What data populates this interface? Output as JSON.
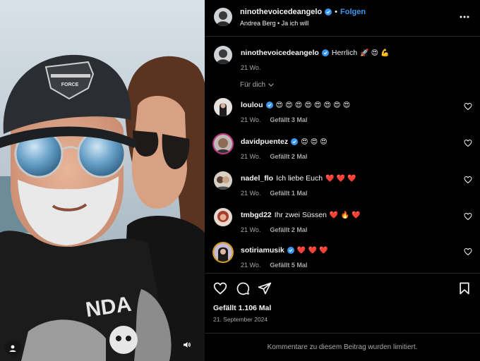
{
  "media": {
    "shirt_text": "NDA",
    "cap_text": "FORCE"
  },
  "header": {
    "username": "ninothevoicedeangelo",
    "separator": "•",
    "follow_label": "Folgen",
    "subtitle": "Andrea Berg • Ja ich will"
  },
  "caption": {
    "username": "ninothevoicedeangelo",
    "text": "Herrlich",
    "emojis": "🚀 😍 💪",
    "time": "21 Wo."
  },
  "filter": {
    "label": "Für dich"
  },
  "comments": [
    {
      "username": "loulou",
      "verified": true,
      "text": "",
      "emojis": "😍 😍 😍 😍 😍 😍 😍 😍",
      "time": "21 Wo.",
      "likes": "Gefällt 3 Mal"
    },
    {
      "username": "davidpuentez",
      "verified": true,
      "text": "",
      "emojis": "😍 😍 😍",
      "time": "21 Wo.",
      "likes": "Gefällt 2 Mal"
    },
    {
      "username": "nadel_flo",
      "verified": false,
      "text": "Ich liebe Euch",
      "emojis": "❤️ ❤️ ❤️",
      "time": "21 Wo.",
      "likes": "Gefällt 1 Mal"
    },
    {
      "username": "tmbgd22",
      "verified": false,
      "text": "Ihr zwei Süssen",
      "emojis": "❤️ 🔥 ❤️",
      "time": "21 Wo.",
      "likes": "Gefällt 2 Mal"
    },
    {
      "username": "sotiriamusik",
      "verified": true,
      "text": "",
      "emojis": "❤️ ❤️ ❤️",
      "time": "21 Wo.",
      "likes": "Gefällt 5 Mal"
    }
  ],
  "post": {
    "likes": "Gefällt 1.106 Mal",
    "date": "21. September 2024"
  },
  "footer": {
    "notice": "Kommentare zu diesem Beitrag wurden limitiert."
  },
  "colors": {
    "background": "#000000",
    "accent": "#3897f0",
    "heart": "#ed4956",
    "divider": "#262626",
    "muted": "#a8a8a8"
  }
}
